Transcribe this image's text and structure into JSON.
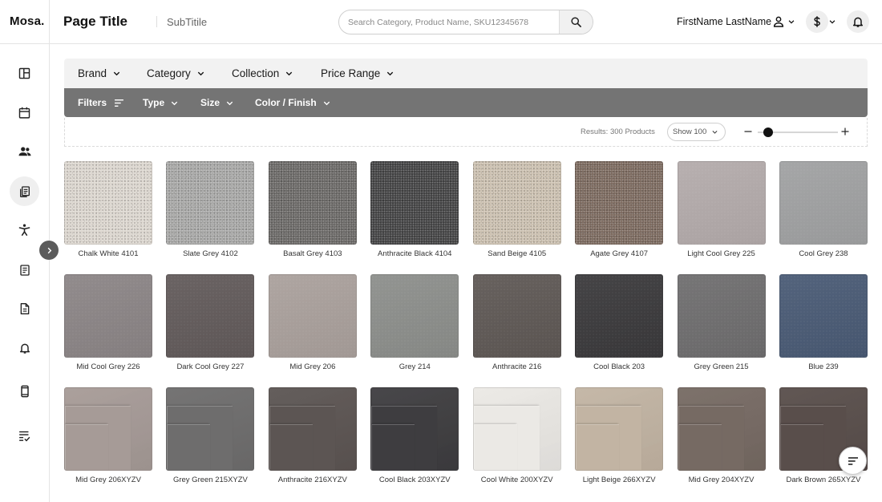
{
  "header": {
    "logo": "Mosa.",
    "page_title": "Page Title",
    "subtitle": "SubTitile",
    "search_placeholder": "Search Category, Product Name, SKU12345678",
    "search_value": "",
    "user_name": "FirstName LastName",
    "icons": [
      "user-icon",
      "dollar-icon",
      "bell-icon",
      "search-icon"
    ]
  },
  "sidebar": {
    "items": [
      {
        "icon": "dashboard-icon",
        "active": false
      },
      {
        "icon": "calendar-icon",
        "active": false
      },
      {
        "icon": "people-icon",
        "active": false
      },
      {
        "icon": "documents-icon",
        "active": true
      },
      {
        "icon": "accessibility-icon",
        "active": false
      },
      {
        "icon": "notes-icon",
        "active": false
      },
      {
        "icon": "file-icon",
        "active": false
      },
      {
        "icon": "bell-icon",
        "active": false
      },
      {
        "icon": "phone-icon",
        "active": false
      },
      {
        "icon": "checklist-icon",
        "active": false
      }
    ],
    "toggle_icon": "chevron-right-icon"
  },
  "filters": {
    "primary": [
      "Brand",
      "Category",
      "Collection",
      "Price Range"
    ],
    "secondary": [
      "Filters",
      "Type",
      "Size",
      "Color / Finish"
    ]
  },
  "results": {
    "text": "Results: 300 Products",
    "show": "Show 100",
    "zoom_level": 0.13
  },
  "products": [
    {
      "name": "Chalk White 4101",
      "color": "#ddd7d0",
      "style": "speckle"
    },
    {
      "name": "Slate Grey 4102",
      "color": "#a9a9a8",
      "style": "speckle"
    },
    {
      "name": "Basalt Grey 4103",
      "color": "#6c6a68",
      "style": "speckle"
    },
    {
      "name": "Anthracite Black 4104",
      "color": "#444445",
      "style": "speckle"
    },
    {
      "name": "Sand Beige 4105",
      "color": "#cdc2b1",
      "style": "speckle"
    },
    {
      "name": "Agate Grey 4107",
      "color": "#7d6b60",
      "style": "speckle"
    },
    {
      "name": "Light Cool Grey 225",
      "color": "#b3abab",
      "style": "plain"
    },
    {
      "name": "Cool Grey 238",
      "color": "#a0a1a2",
      "style": "plain"
    },
    {
      "name": "Mid Cool Grey 226",
      "color": "#8b8586",
      "style": "plain"
    },
    {
      "name": "Dark Cool Grey 227",
      "color": "#625b5b",
      "style": "plain"
    },
    {
      "name": "Mid Grey 206",
      "color": "#aaa09c",
      "style": "plain"
    },
    {
      "name": "Grey 214",
      "color": "#8c8e8b",
      "style": "plain"
    },
    {
      "name": "Anthracite 216",
      "color": "#5f5855",
      "style": "plain"
    },
    {
      "name": "Cool Black 203",
      "color": "#3b3a3c",
      "style": "plain"
    },
    {
      "name": "Grey Green 215",
      "color": "#6f6e6f",
      "style": "plain"
    },
    {
      "name": "Blue 239",
      "color": "#4a5b75",
      "style": "plain"
    },
    {
      "name": "Mid Grey 206XYZV",
      "color": "#a69b97",
      "style": "tiles"
    },
    {
      "name": "Grey Green 215XYZV",
      "color": "#6e6d6d",
      "style": "tiles"
    },
    {
      "name": "Anthracite 216XYZV",
      "color": "#5c5553",
      "style": "tiles"
    },
    {
      "name": "Cool Black 203XYZV",
      "color": "#3e3d40",
      "style": "tiles"
    },
    {
      "name": "Cool White 200XYZV",
      "color": "#ebe9e5",
      "style": "tiles"
    },
    {
      "name": "Light Beige 266XYZV",
      "color": "#c2b4a3",
      "style": "tiles"
    },
    {
      "name": "Mid Grey 204XYZV",
      "color": "#766a63",
      "style": "tiles"
    },
    {
      "name": "Dark Brown 265XYZV",
      "color": "#594e4b",
      "style": "tiles"
    }
  ],
  "fab_icon": "sort-icon"
}
